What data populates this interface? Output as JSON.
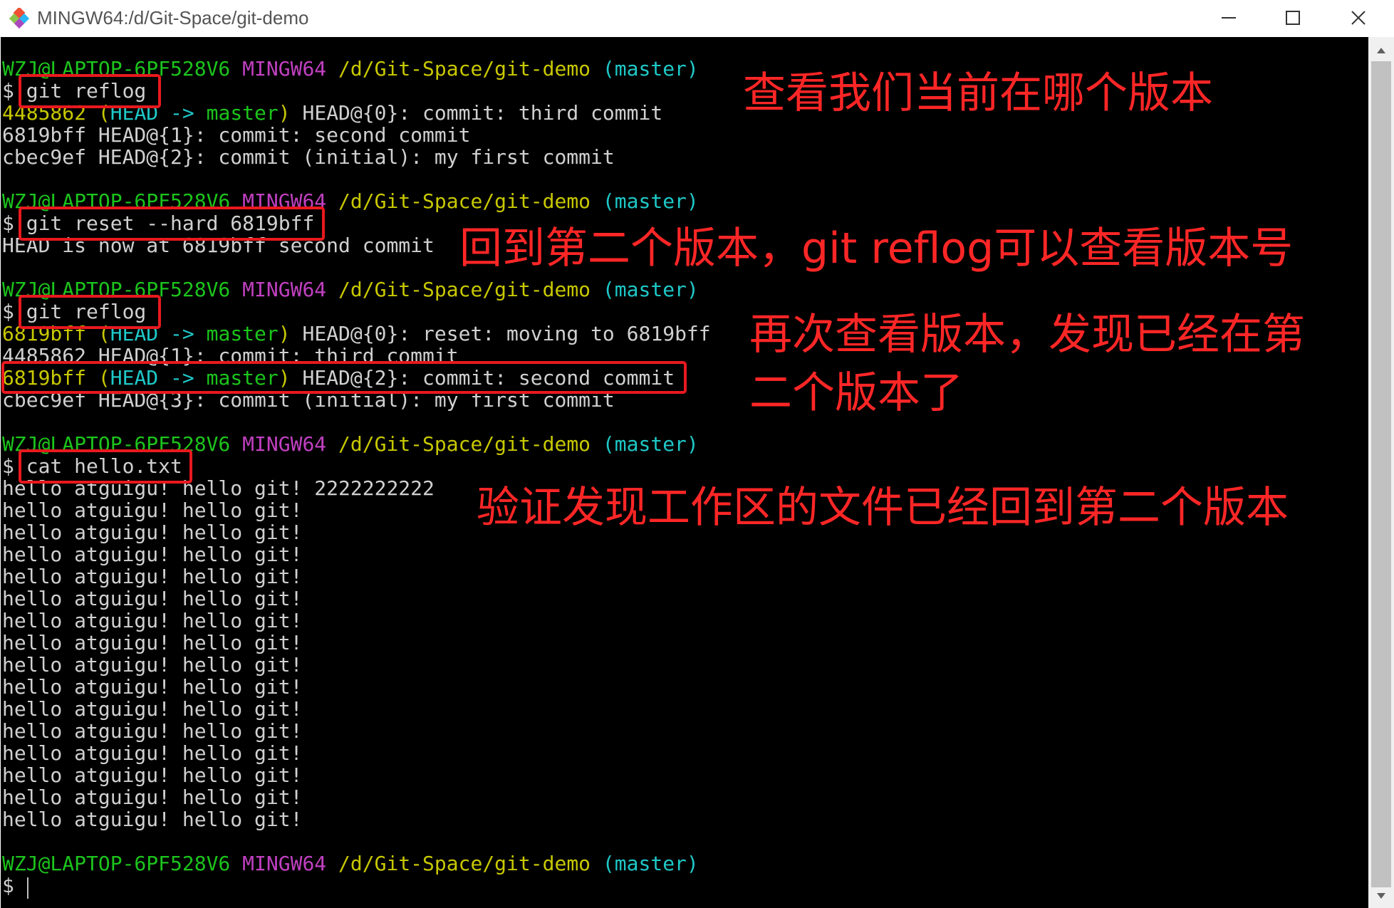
{
  "window": {
    "title": "MINGW64:/d/Git-Space/git-demo",
    "controls": {
      "minimize": "minimize-icon",
      "maximize": "maximize-icon",
      "close": "close-icon"
    }
  },
  "prompt": {
    "user": "WZJ@LAPTOP-6PF528V6",
    "env": "MINGW64",
    "path": "/d/Git-Space/git-demo",
    "branch": "(master)",
    "symbol": "$"
  },
  "commands": {
    "reflog1": "git reflog",
    "reset": "git reset --hard 6819bff",
    "reflog2": "git reflog",
    "cat": "cat hello.txt"
  },
  "reflog1": {
    "l1": {
      "hash": "4485862",
      "ref_open": "(",
      "ref_head": "HEAD",
      "ref_arrow": "->",
      "ref_branch": "master",
      "ref_close": ")",
      "rest": "HEAD@{0}: commit: third commit"
    },
    "l2": "6819bff HEAD@{1}: commit: second commit",
    "l3": "cbec9ef HEAD@{2}: commit (initial): my first commit"
  },
  "reset_output": "HEAD is now at 6819bff second commit",
  "reflog2": {
    "l1": {
      "hash": "6819bff",
      "ref_open": "(",
      "ref_head": "HEAD",
      "ref_arrow": "->",
      "ref_branch": "master",
      "ref_close": ")",
      "rest": "HEAD@{0}: reset: moving to 6819bff"
    },
    "l2": "4485862 HEAD@{1}: commit: third commit",
    "l3": {
      "hash": "6819bff",
      "ref_open": "(",
      "ref_head": "HEAD",
      "ref_arrow": "->",
      "ref_branch": "master",
      "ref_close": ")",
      "rest": "HEAD@{2}: commit: second commit"
    },
    "l4": "cbec9ef HEAD@{3}: commit (initial): my first commit"
  },
  "file_lines": [
    "hello atguigu! hello git! 2222222222",
    "hello atguigu! hello git!",
    "hello atguigu! hello git!",
    "hello atguigu! hello git!",
    "hello atguigu! hello git!",
    "hello atguigu! hello git!",
    "hello atguigu! hello git!",
    "hello atguigu! hello git!",
    "hello atguigu! hello git!",
    "hello atguigu! hello git!",
    "hello atguigu! hello git!",
    "hello atguigu! hello git!",
    "hello atguigu! hello git!",
    "hello atguigu! hello git!",
    "hello atguigu! hello git!",
    "hello atguigu! hello git!"
  ],
  "annotations": {
    "a1": "查看我们当前在哪个版本",
    "a2": "回到第二个版本，git reflog可以查看版本号",
    "a3_l1": "再次查看版本，发现已经在第",
    "a3_l2": "二个版本了",
    "a4": "验证发现工作区的文件已经回到第二个版本"
  },
  "colors": {
    "terminal_bg": "#000000",
    "user_green": "#1cc41c",
    "env_magenta": "#c040c0",
    "path_yellow": "#c8c800",
    "branch_cyan": "#1fc8c8",
    "annotation_red": "#ff2626"
  }
}
